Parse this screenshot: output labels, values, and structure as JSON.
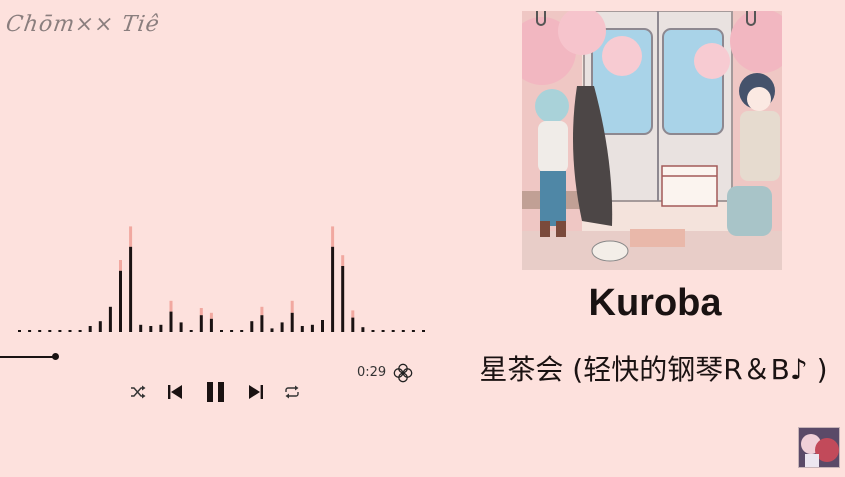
{
  "brand": {
    "text": "Chōm×× Tiê"
  },
  "player": {
    "elapsed": "0:29",
    "progress_fraction": 0.07,
    "controls": {
      "shuffle": "shuffle-icon",
      "previous": "skip-previous-icon",
      "play_pause": "pause-icon",
      "next": "skip-next-icon",
      "repeat": "repeat-icon"
    },
    "clover_icon": "clover-icon"
  },
  "track": {
    "title": "Kuroba",
    "artist": "星茶会 (轻快的钢琴R＆B♪ )"
  },
  "visualizer": {
    "bar_levels": [
      0,
      0,
      0,
      0,
      0,
      0,
      0,
      0.05,
      0.09,
      0.21,
      0.51,
      0.71,
      0.06,
      0.05,
      0.06,
      0.17,
      0.08,
      0,
      0.14,
      0.11,
      0,
      0,
      0,
      0.09,
      0.14,
      0.03,
      0.08,
      0.16,
      0.05,
      0.06,
      0.1,
      0.71,
      0.55,
      0.12,
      0.04,
      0,
      0,
      0,
      0,
      0,
      0
    ],
    "peak_levels": [
      0,
      0,
      0,
      0,
      0,
      0,
      0,
      0.05,
      0.09,
      0.21,
      0.6,
      0.88,
      0.06,
      0.05,
      0.06,
      0.26,
      0.08,
      0,
      0.2,
      0.16,
      0,
      0,
      0,
      0.09,
      0.21,
      0.03,
      0.08,
      0.26,
      0.05,
      0.06,
      0.1,
      0.88,
      0.64,
      0.18,
      0.04,
      0,
      0,
      0,
      0,
      0,
      0
    ],
    "bar_color": "#1a1212",
    "peak_color": "#f1a8a0"
  },
  "colors": {
    "background": "#fde1dd",
    "text": "#1a1212"
  }
}
